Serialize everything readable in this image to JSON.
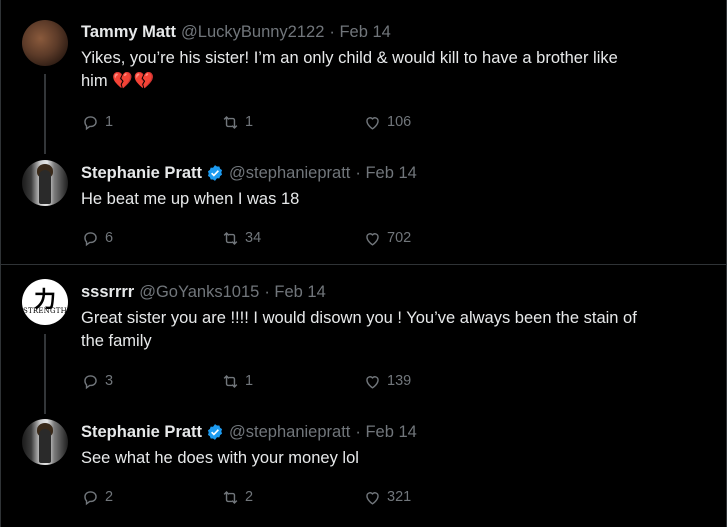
{
  "tweets": [
    {
      "name": "Tammy Matt",
      "handle": "@LuckyBunny2122",
      "date": "· Feb 14",
      "verified": false,
      "text_line1": "Yikes, you’re his sister! I’m an only child & would kill to have a brother like",
      "text_line2": "him",
      "emoji": "💔💔",
      "replies": "1",
      "retweets": "1",
      "likes": "106"
    },
    {
      "name": "Stephanie Pratt",
      "handle": "@stephaniepratt",
      "date": "· Feb 14",
      "verified": true,
      "text_line1": "He beat me up when I was 18",
      "replies": "6",
      "retweets": "34",
      "likes": "702"
    },
    {
      "name": "sssrrrr",
      "handle": "@GoYanks1015",
      "date": "· Feb 14",
      "verified": false,
      "avatar_kanji": "力",
      "avatar_word": "STRENGTH",
      "text_line1": "Great sister you are !!!! I would disown you ! You’ve always been the stain of",
      "text_line2": "the family",
      "replies": "3",
      "retweets": "1",
      "likes": "139"
    },
    {
      "name": "Stephanie Pratt",
      "handle": "@stephaniepratt",
      "date": "· Feb 14",
      "verified": true,
      "text_line1": "See what he does with your money lol",
      "replies": "2",
      "retweets": "2",
      "likes": "321"
    }
  ],
  "colors": {
    "background": "#000000",
    "text": "#e7e9ea",
    "muted": "#71767b",
    "verified": "#1d9bf0",
    "divider": "#2f3336"
  },
  "icons": {
    "reply": "reply-icon",
    "retweet": "retweet-icon",
    "like": "heart-icon",
    "verified": "verified-badge-icon"
  }
}
